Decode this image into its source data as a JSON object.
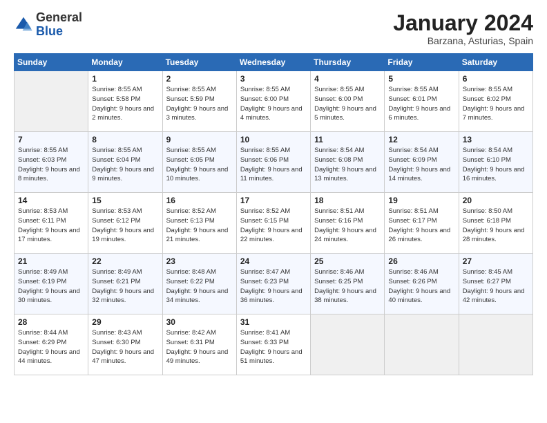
{
  "header": {
    "logo": {
      "general": "General",
      "blue": "Blue"
    },
    "title": "January 2024",
    "location": "Barzana, Asturias, Spain"
  },
  "weekdays": [
    "Sunday",
    "Monday",
    "Tuesday",
    "Wednesday",
    "Thursday",
    "Friday",
    "Saturday"
  ],
  "weeks": [
    [
      {
        "day": "",
        "sunrise": "",
        "sunset": "",
        "daylight": "",
        "empty": true
      },
      {
        "day": "1",
        "sunrise": "Sunrise: 8:55 AM",
        "sunset": "Sunset: 5:58 PM",
        "daylight": "Daylight: 9 hours and 2 minutes."
      },
      {
        "day": "2",
        "sunrise": "Sunrise: 8:55 AM",
        "sunset": "Sunset: 5:59 PM",
        "daylight": "Daylight: 9 hours and 3 minutes."
      },
      {
        "day": "3",
        "sunrise": "Sunrise: 8:55 AM",
        "sunset": "Sunset: 6:00 PM",
        "daylight": "Daylight: 9 hours and 4 minutes."
      },
      {
        "day": "4",
        "sunrise": "Sunrise: 8:55 AM",
        "sunset": "Sunset: 6:00 PM",
        "daylight": "Daylight: 9 hours and 5 minutes."
      },
      {
        "day": "5",
        "sunrise": "Sunrise: 8:55 AM",
        "sunset": "Sunset: 6:01 PM",
        "daylight": "Daylight: 9 hours and 6 minutes."
      },
      {
        "day": "6",
        "sunrise": "Sunrise: 8:55 AM",
        "sunset": "Sunset: 6:02 PM",
        "daylight": "Daylight: 9 hours and 7 minutes."
      }
    ],
    [
      {
        "day": "7",
        "sunrise": "Sunrise: 8:55 AM",
        "sunset": "Sunset: 6:03 PM",
        "daylight": "Daylight: 9 hours and 8 minutes."
      },
      {
        "day": "8",
        "sunrise": "Sunrise: 8:55 AM",
        "sunset": "Sunset: 6:04 PM",
        "daylight": "Daylight: 9 hours and 9 minutes."
      },
      {
        "day": "9",
        "sunrise": "Sunrise: 8:55 AM",
        "sunset": "Sunset: 6:05 PM",
        "daylight": "Daylight: 9 hours and 10 minutes."
      },
      {
        "day": "10",
        "sunrise": "Sunrise: 8:55 AM",
        "sunset": "Sunset: 6:06 PM",
        "daylight": "Daylight: 9 hours and 11 minutes."
      },
      {
        "day": "11",
        "sunrise": "Sunrise: 8:54 AM",
        "sunset": "Sunset: 6:08 PM",
        "daylight": "Daylight: 9 hours and 13 minutes."
      },
      {
        "day": "12",
        "sunrise": "Sunrise: 8:54 AM",
        "sunset": "Sunset: 6:09 PM",
        "daylight": "Daylight: 9 hours and 14 minutes."
      },
      {
        "day": "13",
        "sunrise": "Sunrise: 8:54 AM",
        "sunset": "Sunset: 6:10 PM",
        "daylight": "Daylight: 9 hours and 16 minutes."
      }
    ],
    [
      {
        "day": "14",
        "sunrise": "Sunrise: 8:53 AM",
        "sunset": "Sunset: 6:11 PM",
        "daylight": "Daylight: 9 hours and 17 minutes."
      },
      {
        "day": "15",
        "sunrise": "Sunrise: 8:53 AM",
        "sunset": "Sunset: 6:12 PM",
        "daylight": "Daylight: 9 hours and 19 minutes."
      },
      {
        "day": "16",
        "sunrise": "Sunrise: 8:52 AM",
        "sunset": "Sunset: 6:13 PM",
        "daylight": "Daylight: 9 hours and 21 minutes."
      },
      {
        "day": "17",
        "sunrise": "Sunrise: 8:52 AM",
        "sunset": "Sunset: 6:15 PM",
        "daylight": "Daylight: 9 hours and 22 minutes."
      },
      {
        "day": "18",
        "sunrise": "Sunrise: 8:51 AM",
        "sunset": "Sunset: 6:16 PM",
        "daylight": "Daylight: 9 hours and 24 minutes."
      },
      {
        "day": "19",
        "sunrise": "Sunrise: 8:51 AM",
        "sunset": "Sunset: 6:17 PM",
        "daylight": "Daylight: 9 hours and 26 minutes."
      },
      {
        "day": "20",
        "sunrise": "Sunrise: 8:50 AM",
        "sunset": "Sunset: 6:18 PM",
        "daylight": "Daylight: 9 hours and 28 minutes."
      }
    ],
    [
      {
        "day": "21",
        "sunrise": "Sunrise: 8:49 AM",
        "sunset": "Sunset: 6:19 PM",
        "daylight": "Daylight: 9 hours and 30 minutes."
      },
      {
        "day": "22",
        "sunrise": "Sunrise: 8:49 AM",
        "sunset": "Sunset: 6:21 PM",
        "daylight": "Daylight: 9 hours and 32 minutes."
      },
      {
        "day": "23",
        "sunrise": "Sunrise: 8:48 AM",
        "sunset": "Sunset: 6:22 PM",
        "daylight": "Daylight: 9 hours and 34 minutes."
      },
      {
        "day": "24",
        "sunrise": "Sunrise: 8:47 AM",
        "sunset": "Sunset: 6:23 PM",
        "daylight": "Daylight: 9 hours and 36 minutes."
      },
      {
        "day": "25",
        "sunrise": "Sunrise: 8:46 AM",
        "sunset": "Sunset: 6:25 PM",
        "daylight": "Daylight: 9 hours and 38 minutes."
      },
      {
        "day": "26",
        "sunrise": "Sunrise: 8:46 AM",
        "sunset": "Sunset: 6:26 PM",
        "daylight": "Daylight: 9 hours and 40 minutes."
      },
      {
        "day": "27",
        "sunrise": "Sunrise: 8:45 AM",
        "sunset": "Sunset: 6:27 PM",
        "daylight": "Daylight: 9 hours and 42 minutes."
      }
    ],
    [
      {
        "day": "28",
        "sunrise": "Sunrise: 8:44 AM",
        "sunset": "Sunset: 6:29 PM",
        "daylight": "Daylight: 9 hours and 44 minutes."
      },
      {
        "day": "29",
        "sunrise": "Sunrise: 8:43 AM",
        "sunset": "Sunset: 6:30 PM",
        "daylight": "Daylight: 9 hours and 47 minutes."
      },
      {
        "day": "30",
        "sunrise": "Sunrise: 8:42 AM",
        "sunset": "Sunset: 6:31 PM",
        "daylight": "Daylight: 9 hours and 49 minutes."
      },
      {
        "day": "31",
        "sunrise": "Sunrise: 8:41 AM",
        "sunset": "Sunset: 6:33 PM",
        "daylight": "Daylight: 9 hours and 51 minutes."
      },
      {
        "day": "",
        "sunrise": "",
        "sunset": "",
        "daylight": "",
        "empty": true
      },
      {
        "day": "",
        "sunrise": "",
        "sunset": "",
        "daylight": "",
        "empty": true
      },
      {
        "day": "",
        "sunrise": "",
        "sunset": "",
        "daylight": "",
        "empty": true
      }
    ]
  ]
}
